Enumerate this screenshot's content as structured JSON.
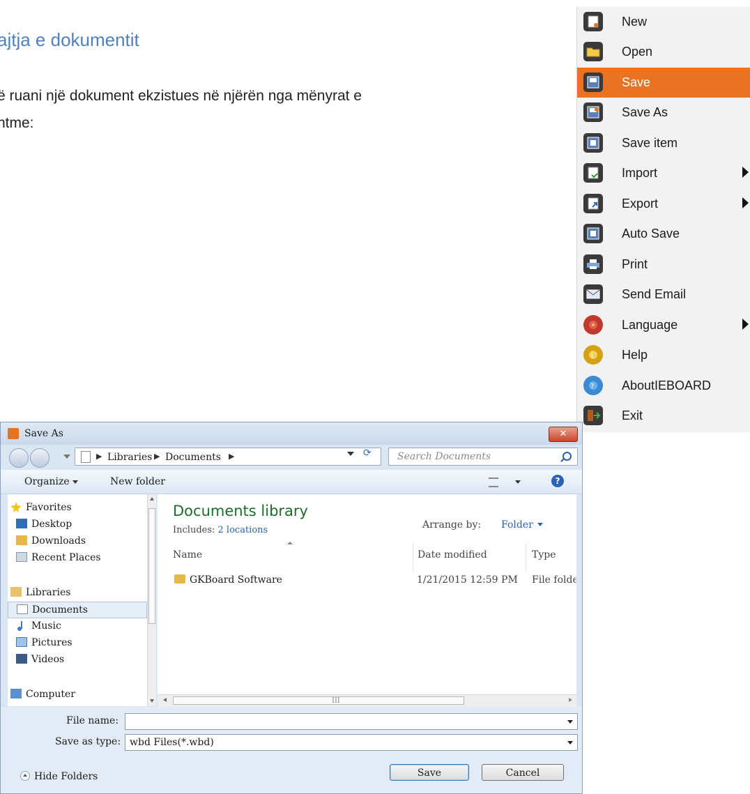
{
  "document": {
    "heading": "ajtja e dokumentit",
    "paragraph": "ë ruani një dokument ekzistues në njërën nga mënyrat e\nntme:"
  },
  "menu": {
    "items": [
      {
        "label": "New",
        "icon": "new-icon",
        "color": "#555555"
      },
      {
        "label": "Open",
        "icon": "open-folder-icon",
        "color": "#555555"
      },
      {
        "label": "Save",
        "icon": "save-icon",
        "color": "#555555",
        "active": true
      },
      {
        "label": "Save As",
        "icon": "save-as-icon",
        "color": "#555555"
      },
      {
        "label": "Save item",
        "icon": "save-item-icon",
        "color": "#555555"
      },
      {
        "label": "Import",
        "icon": "import-icon",
        "color": "#555555",
        "submenu": true
      },
      {
        "label": "Export",
        "icon": "export-icon",
        "color": "#555555",
        "submenu": true
      },
      {
        "label": "Auto Save",
        "icon": "auto-save-icon",
        "color": "#555555"
      },
      {
        "label": "Print",
        "icon": "print-icon",
        "color": "#555555"
      },
      {
        "label": "Send Email",
        "icon": "email-icon",
        "color": "#555555"
      },
      {
        "label": "Language",
        "icon": "language-icon",
        "color": "#c0392b",
        "submenu": true
      },
      {
        "label": "Help",
        "icon": "help-icon",
        "color": "#d4a017"
      },
      {
        "label": "AboutIEBOARD",
        "icon": "about-icon",
        "color": "#3a8bd6"
      },
      {
        "label": "Exit",
        "icon": "exit-icon",
        "color": "#555555"
      }
    ],
    "active_color": "#e97323"
  },
  "dialog": {
    "title": "Save As",
    "close_label": "✕",
    "breadcrumb": [
      "Libraries",
      "Documents"
    ],
    "search_placeholder": "Search Documents",
    "toolbar": {
      "organize": "Organize",
      "new_folder": "New folder",
      "help": "?"
    },
    "nav": {
      "favorites": "Favorites",
      "desktop": "Desktop",
      "downloads": "Downloads",
      "recent_places": "Recent Places",
      "libraries": "Libraries",
      "documents": "Documents",
      "music": "Music",
      "pictures": "Pictures",
      "videos": "Videos",
      "computer": "Computer"
    },
    "library": {
      "title": "Documents library",
      "includes_prefix": "Includes:",
      "includes_link": "2 locations",
      "arrange_by": "Arrange by:",
      "arrange_value": "Folder"
    },
    "columns": [
      "Name",
      "Date modified",
      "Type"
    ],
    "files": [
      {
        "name": "GKBoard Software",
        "date": "1/21/2015 12:59 PM",
        "type": "File folder"
      }
    ],
    "file_name_label": "File name:",
    "file_name_value": "",
    "save_type_label": "Save as type:",
    "save_type_value": "wbd Files(*.wbd)",
    "hide_folders": "Hide Folders",
    "save_button": "Save",
    "cancel_button": "Cancel"
  }
}
